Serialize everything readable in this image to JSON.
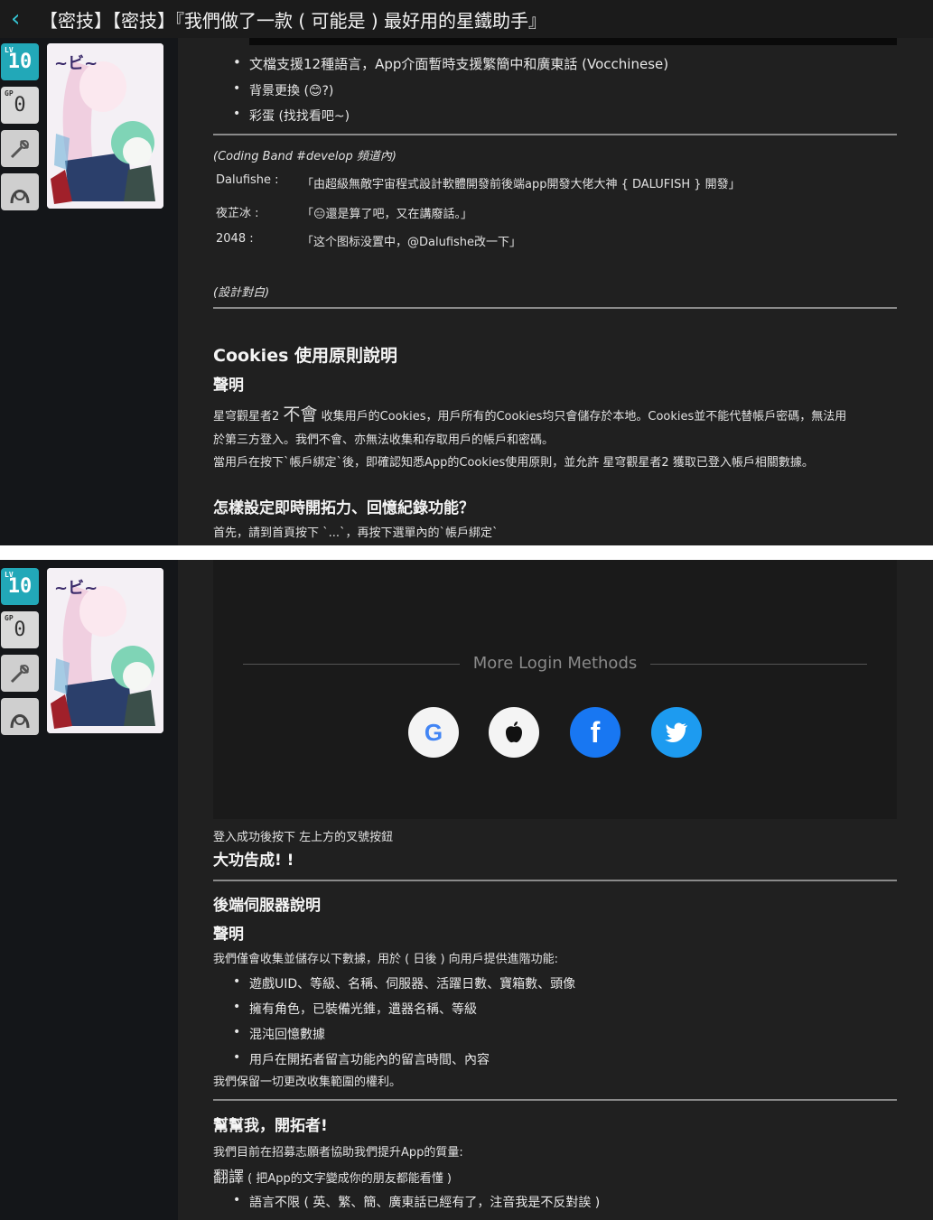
{
  "header": {
    "back_icon": "chevron-left-icon",
    "title": "【密技】【密技】『我們做了一款 ( 可能是 ) 最好用的星鐵助手』"
  },
  "sidebar": {
    "level_prefix": "LV",
    "level": "10",
    "gp_prefix": "GP",
    "gp": "0",
    "tool_icon": "wrench-icon",
    "guild_icon": "helmet-icon",
    "avatar_alt": "anime character avatar"
  },
  "section1": {
    "bullets": [
      "文檔支援12種語言，App介面暫時支援繁簡中和廣東話 (Vocchinese)",
      "背景更換 (😊?)",
      "彩蛋 (找找看吧~)"
    ],
    "coding_note": "(Coding Band #develop 頻道內)",
    "dialogue": [
      {
        "name": "Dalufishe :",
        "text": "「由超級無敵宇宙程式設計軟體開發前後端app開發大佬大神 { DALUFISH } 開發」"
      },
      {
        "name": "夜芷冰 :",
        "text": "「😑還是算了吧，又在講廢話。」"
      },
      {
        "name": "2048 :",
        "text": "「这个图标没置中，@Dalufishe改一下」"
      }
    ],
    "design_note": "(設計對白)",
    "cookies_title": "Cookies 使用原則說明",
    "statement": "聲明",
    "cookies_p1a": "星穹觀星者2",
    "cookies_p1b": "不會",
    "cookies_p1c": "收集用戶的Cookies，用戶所有的Cookies均只會儲存於本地。Cookies並不能代替帳戶密碼，無法用",
    "cookies_p2": "於第三方登入。我們不會、亦無法收集和存取用戶的帳戶和密碼。",
    "cookies_p3": "當用戶在按下`帳戶綁定`後，即確認知悉App的Cookies使用原則，並允許 星穹觀星者2 獲取已登入帳戶相關數據。",
    "howto_title": "怎樣設定即時開拓力、回憶紀錄功能？",
    "howto_p": "首先，請到首頁按下 `...`，再按下選單內的`帳戶綁定`"
  },
  "section2": {
    "more_login": "More Login Methods",
    "social": [
      {
        "name": "google-login-button",
        "icon": "google-icon",
        "glyph": "G"
      },
      {
        "name": "apple-login-button",
        "icon": "apple-icon",
        "glyph": ""
      },
      {
        "name": "facebook-login-button",
        "icon": "facebook-icon",
        "glyph": "f"
      },
      {
        "name": "twitter-login-button",
        "icon": "twitter-icon",
        "glyph": "🐦"
      }
    ],
    "after_login": "登入成功後按下 左上方的叉號按鈕",
    "done": "大功告成! !",
    "server_title": "後端伺服器說明",
    "statement": "聲明",
    "server_p": "我們僅會收集並儲存以下數據，用於 ( 日後 ) 向用戶提供進階功能:",
    "server_bullets": [
      "遊戲UID、等級、名稱、伺服器、活躍日數、寶箱數、頭像",
      "擁有角色，已裝備光錐，遺器名稱、等級",
      "混沌回憶數據",
      "用戶在開拓者留言功能內的留言時間、內容"
    ],
    "reserve": "我們保留一切更改收集範圍的權利。",
    "help_title": "幫幫我，開拓者!",
    "help_p": "我們目前在招募志願者協助我們提升App的質量:",
    "translate_a": "翻譯",
    "translate_b": " ( 把App的文字變成你的朋友都能看懂 )",
    "translate_bullet": "語言不限 ( 英、繁、簡、廣東話已經有了，注音我是不反對誒 )"
  },
  "colors": {
    "accent": "#35c6d4",
    "level_badge": "#22a8b8",
    "facebook": "#1877f2",
    "twitter": "#1d9bf0"
  }
}
